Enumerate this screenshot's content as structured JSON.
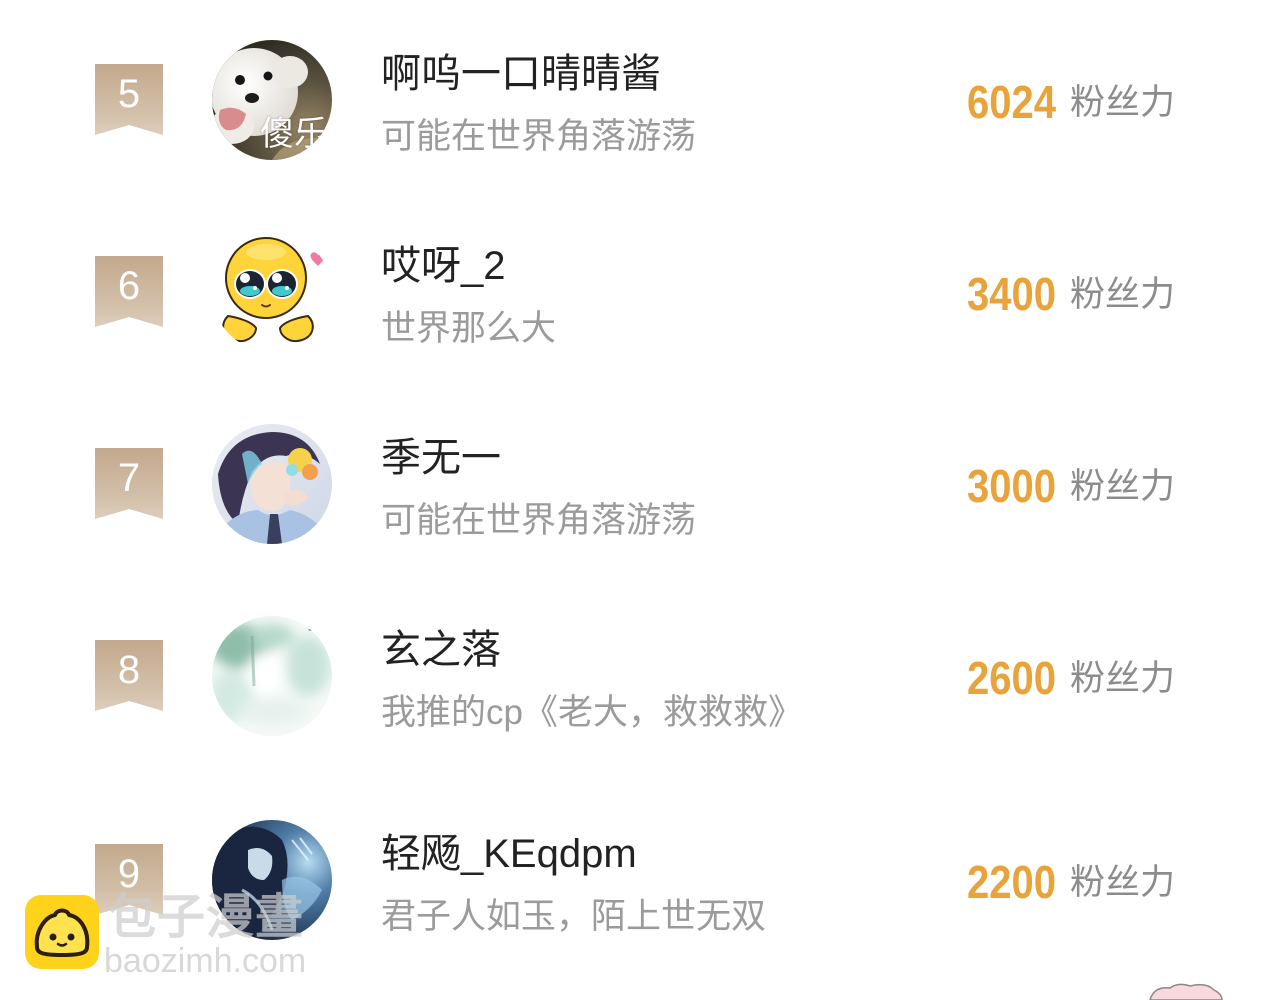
{
  "ranking": {
    "unit_label": "粉丝力",
    "items": [
      {
        "rank": 5,
        "name": "啊呜一口晴晴酱",
        "bio": "可能在世界角落游荡",
        "score": 6024,
        "avatar": {
          "icon": "samoyed-puppy-avatar",
          "overlay_text": "傻乐"
        }
      },
      {
        "rank": 6,
        "name": "哎呀_2",
        "bio": "世界那么大",
        "score": 3400,
        "avatar": {
          "icon": "crying-yellow-emoji-avatar"
        }
      },
      {
        "rank": 7,
        "name": "季无一",
        "bio": "可能在世界角落游荡",
        "score": 3000,
        "avatar": {
          "icon": "anime-boy-avatar"
        }
      },
      {
        "rank": 8,
        "name": "玄之落",
        "bio": "我推的cp《老大，救救救》",
        "score": 2600,
        "avatar": {
          "icon": "misty-landscape-avatar"
        }
      },
      {
        "rank": 9,
        "name": "轻飏_KEqdpm",
        "bio": "君子人如玉，陌上世无双",
        "score": 2200,
        "avatar": {
          "icon": "dark-anime-character-avatar"
        }
      }
    ]
  },
  "watermark": {
    "logo_icon": "baozi-bun-logo-icon",
    "title": "包子漫畫",
    "site": "baozimh.com"
  },
  "decoration": {
    "icon": "pink-sticker-icon"
  },
  "colors": {
    "rank_badge": "#c9b194",
    "score": "#e9a33b",
    "name": "#222222",
    "bio": "#9b9b9b",
    "unit": "#8c8c8c",
    "watermark_logo": "#ffd21c"
  }
}
